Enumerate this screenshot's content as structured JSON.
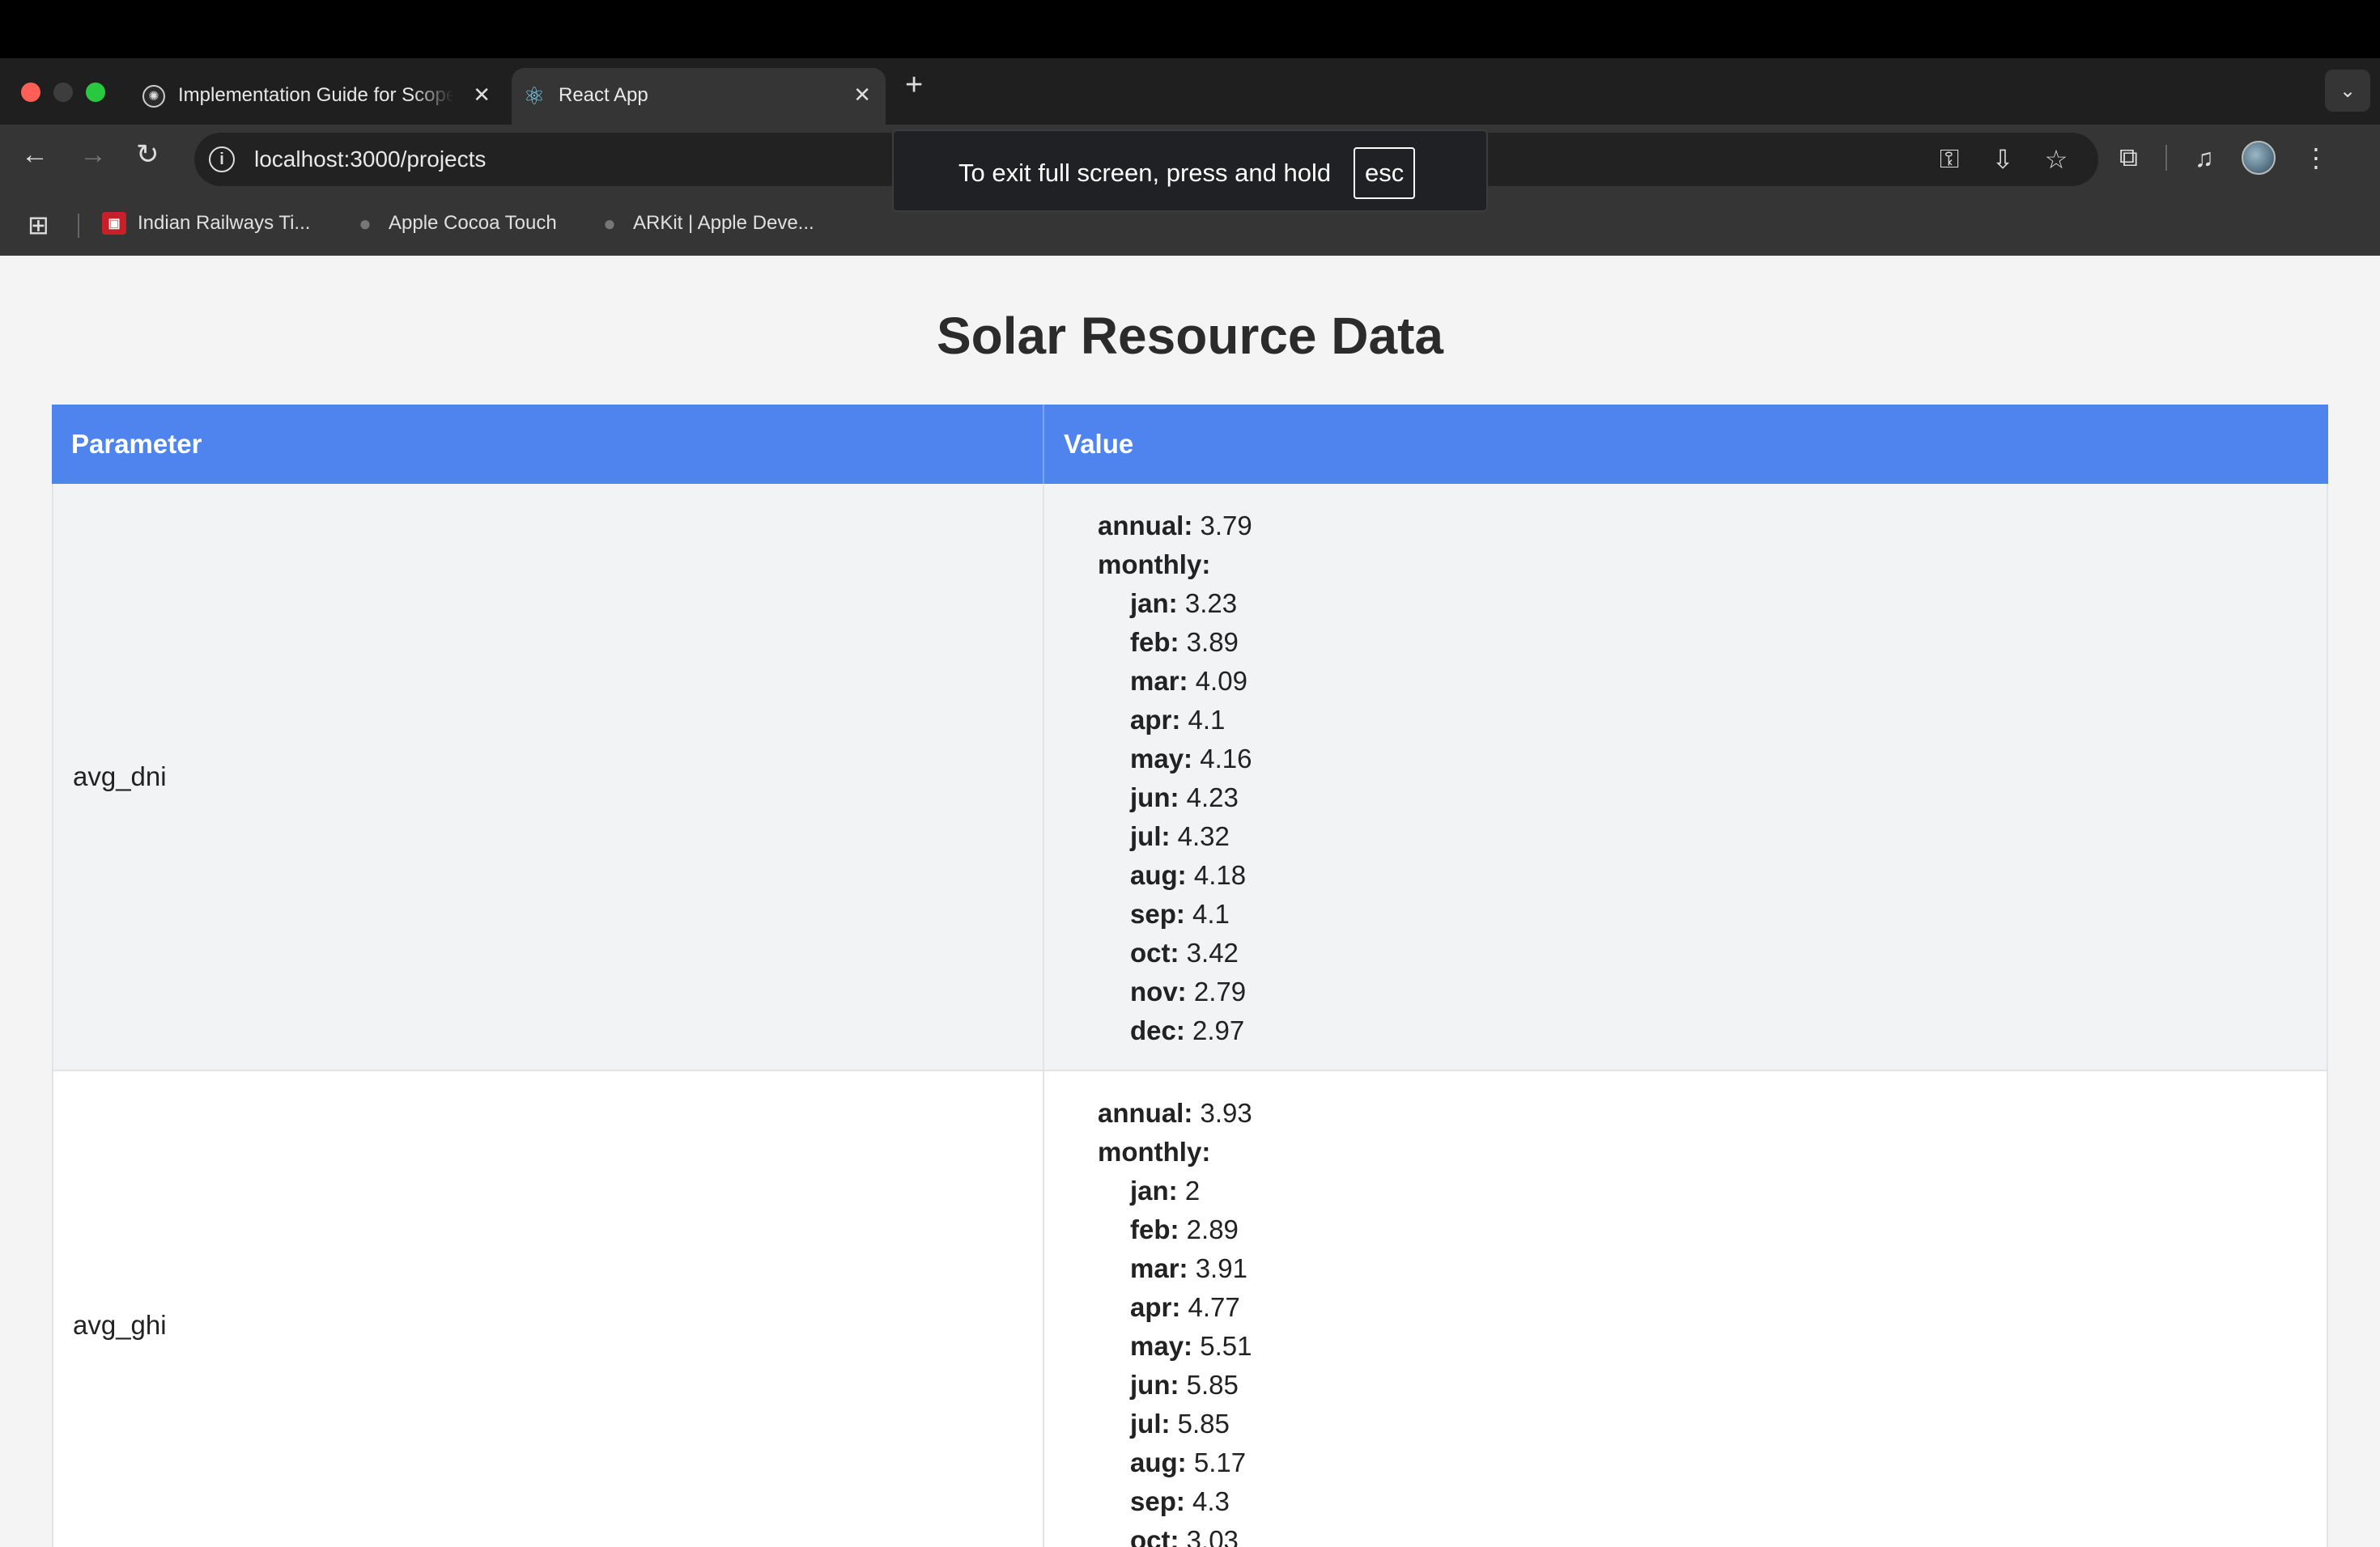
{
  "browser": {
    "tabs": [
      {
        "title": "Implementation Guide for Scope",
        "active": false
      },
      {
        "title": "React App",
        "active": true
      }
    ],
    "url": "localhost:3000/projects",
    "bookmarks": [
      "Indian Railways Ti...",
      "Apple Cocoa Touch",
      "ARKit | Apple Deve..."
    ],
    "toast": {
      "text": "To exit full screen, press and hold",
      "key": "esc"
    }
  },
  "page": {
    "title": "Solar Resource Data",
    "headers": {
      "parameter": "Parameter",
      "value": "Value"
    },
    "rows": [
      {
        "parameter": "avg_dni",
        "annual_label": "annual:",
        "annual": "3.79",
        "monthly_label": "monthly:",
        "months": [
          {
            "k": "jan:",
            "v": "3.23"
          },
          {
            "k": "feb:",
            "v": "3.89"
          },
          {
            "k": "mar:",
            "v": "4.09"
          },
          {
            "k": "apr:",
            "v": "4.1"
          },
          {
            "k": "may:",
            "v": "4.16"
          },
          {
            "k": "jun:",
            "v": "4.23"
          },
          {
            "k": "jul:",
            "v": "4.32"
          },
          {
            "k": "aug:",
            "v": "4.18"
          },
          {
            "k": "sep:",
            "v": "4.1"
          },
          {
            "k": "oct:",
            "v": "3.42"
          },
          {
            "k": "nov:",
            "v": "2.79"
          },
          {
            "k": "dec:",
            "v": "2.97"
          }
        ]
      },
      {
        "parameter": "avg_ghi",
        "annual_label": "annual:",
        "annual": "3.93",
        "monthly_label": "monthly:",
        "months": [
          {
            "k": "jan:",
            "v": "2"
          },
          {
            "k": "feb:",
            "v": "2.89"
          },
          {
            "k": "mar:",
            "v": "3.91"
          },
          {
            "k": "apr:",
            "v": "4.77"
          },
          {
            "k": "may:",
            "v": "5.51"
          },
          {
            "k": "jun:",
            "v": "5.85"
          },
          {
            "k": "jul:",
            "v": "5.85"
          },
          {
            "k": "aug:",
            "v": "5.17"
          },
          {
            "k": "sep:",
            "v": "4.3"
          },
          {
            "k": "oct:",
            "v": "3.03"
          }
        ]
      }
    ]
  }
}
